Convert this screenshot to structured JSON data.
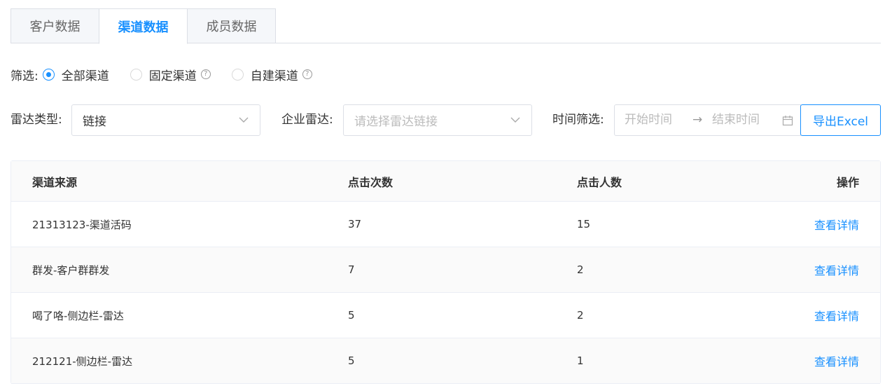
{
  "tabs": [
    {
      "label": "客户数据",
      "active": false
    },
    {
      "label": "渠道数据",
      "active": true
    },
    {
      "label": "成员数据",
      "active": false
    }
  ],
  "filter": {
    "label": "筛选:",
    "options": [
      {
        "label": "全部渠道",
        "checked": true
      },
      {
        "label": "固定渠道",
        "checked": false,
        "help": "?"
      },
      {
        "label": "自建渠道",
        "checked": false,
        "help": "?"
      }
    ]
  },
  "selectors": {
    "radar_type_label": "雷达类型:",
    "radar_type_value": "链接",
    "enterprise_radar_label": "企业雷达:",
    "enterprise_radar_placeholder": "请选择雷达链接",
    "time_filter_label": "时间筛选:",
    "start_placeholder": "开始时间",
    "range_separator": "→",
    "end_placeholder": "结束时间",
    "export_label": "导出Excel"
  },
  "table": {
    "columns": [
      "渠道来源",
      "点击次数",
      "点击人数",
      "操作"
    ],
    "rows": [
      {
        "source": "21313123-渠道活码",
        "clicks": "37",
        "users": "15",
        "action": "查看详情"
      },
      {
        "source": "群发-客户群群发",
        "clicks": "7",
        "users": "2",
        "action": "查看详情"
      },
      {
        "source": "喝了咯-侧边栏-雷达",
        "clicks": "5",
        "users": "2",
        "action": "查看详情"
      },
      {
        "source": "212121-侧边栏-雷达",
        "clicks": "5",
        "users": "1",
        "action": "查看详情"
      }
    ]
  },
  "colors": {
    "accent": "#1890ff",
    "border": "#dcdfe6",
    "header_bg": "#fafafa"
  }
}
